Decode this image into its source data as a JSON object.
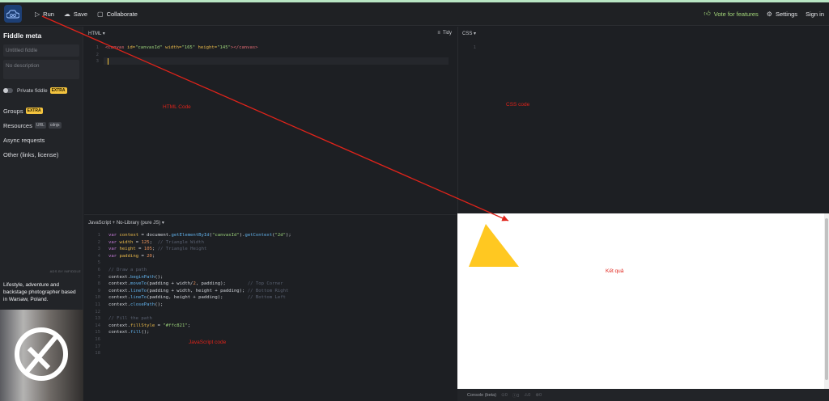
{
  "topbar": {
    "run": "Run",
    "save": "Save",
    "collaborate": "Collaborate",
    "vote": "Vote for features",
    "settings": "Settings",
    "signin": "Sign in"
  },
  "sidebar": {
    "title": "Fiddle meta",
    "title_placeholder": "Untitled fiddle",
    "desc_placeholder": "No description",
    "private": "Private fiddle",
    "private_badge": "EXTRA",
    "groups": "Groups",
    "groups_badge": "EXTRA",
    "resources": "Resources",
    "res_url": "URL",
    "res_cdnjs": "cdnjs",
    "async": "Async requests",
    "other": "Other (links, license)",
    "ads_label": "ADS BY INFIDDLE",
    "ad_text": "Lifestyle, adventure and backstage photographer based in Warsaw, Poland."
  },
  "html_panel": {
    "title": "HTML ▾",
    "tidy": "Tidy",
    "line_numbers": [
      "1",
      "2",
      "3"
    ],
    "code_line1_tag_open": "<canvas",
    "code_line1_attr1": " id=",
    "code_line1_val1": "\"canvasId\"",
    "code_line1_attr2": " width=",
    "code_line1_val2": "\"165\"",
    "code_line1_attr3": " height=",
    "code_line1_val3": "\"145\"",
    "code_line1_tag_close": "></canvas>",
    "annotation": "HTML Code"
  },
  "css_panel": {
    "title": "CSS ▾",
    "line_numbers": [
      "1"
    ],
    "annotation": "CSS code"
  },
  "js_panel": {
    "title": "JavaScript + No-Library (pure JS) ▾",
    "line_numbers": [
      "1",
      "2",
      "3",
      "4",
      "5",
      "6",
      "7",
      "8",
      "9",
      "10",
      "11",
      "12",
      "13",
      "14",
      "15",
      "16",
      "17",
      "18"
    ],
    "annotation": "JavaScript code"
  },
  "result_panel": {
    "annotation": "Kết quả",
    "triangle_color": "#ffc821"
  },
  "console": {
    "label": "Console (beta)",
    "counts": [
      "0",
      "0",
      "0",
      "0"
    ]
  },
  "colors": {
    "accent_red": "#e0231a",
    "vote_green": "#a4d77a",
    "badge_yellow": "#f3c33f"
  }
}
